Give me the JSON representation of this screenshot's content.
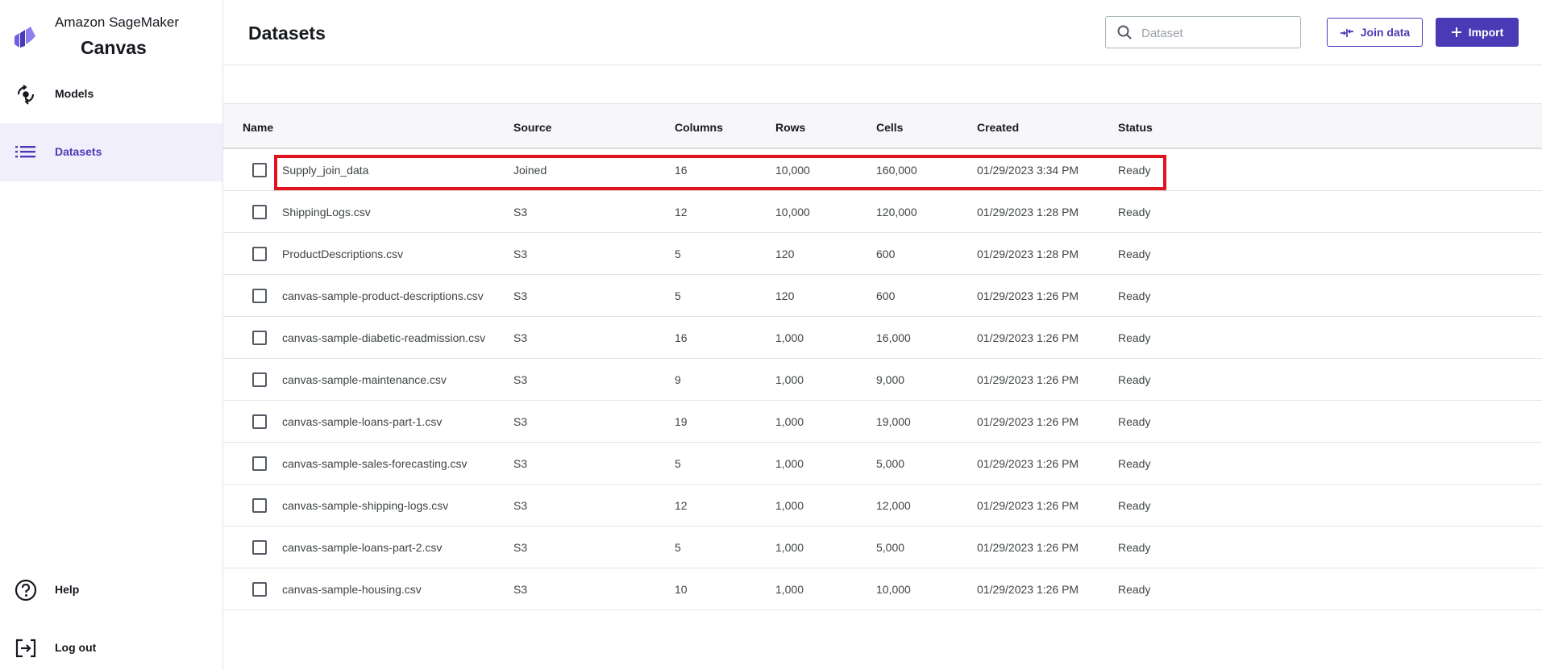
{
  "app": {
    "brand_sub": "Amazon SageMaker",
    "brand_title": "Canvas",
    "accent_color": "#4b3ab5",
    "highlight_color": "#e0141e"
  },
  "sidebar": {
    "items": [
      {
        "label": "Models",
        "icon": "models-icon",
        "active": false
      },
      {
        "label": "Datasets",
        "icon": "list-icon",
        "active": true
      }
    ],
    "bottom_items": [
      {
        "label": "Help",
        "icon": "help-icon"
      },
      {
        "label": "Log out",
        "icon": "logout-icon"
      }
    ]
  },
  "header": {
    "title": "Datasets",
    "search_placeholder": "Dataset",
    "join_label": "Join data",
    "import_label": "Import"
  },
  "table": {
    "columns": [
      "Name",
      "Source",
      "Columns",
      "Rows",
      "Cells",
      "Created",
      "Status"
    ],
    "rows": [
      {
        "name": "Supply_join_data",
        "source": "Joined",
        "columns": "16",
        "rows": "10,000",
        "cells": "160,000",
        "created": "01/29/2023 3:34 PM",
        "status": "Ready",
        "highlighted": true
      },
      {
        "name": "ShippingLogs.csv",
        "source": "S3",
        "columns": "12",
        "rows": "10,000",
        "cells": "120,000",
        "created": "01/29/2023 1:28 PM",
        "status": "Ready"
      },
      {
        "name": "ProductDescriptions.csv",
        "source": "S3",
        "columns": "5",
        "rows": "120",
        "cells": "600",
        "created": "01/29/2023 1:28 PM",
        "status": "Ready"
      },
      {
        "name": "canvas-sample-product-descriptions.csv",
        "source": "S3",
        "columns": "5",
        "rows": "120",
        "cells": "600",
        "created": "01/29/2023 1:26 PM",
        "status": "Ready"
      },
      {
        "name": "canvas-sample-diabetic-readmission.csv",
        "source": "S3",
        "columns": "16",
        "rows": "1,000",
        "cells": "16,000",
        "created": "01/29/2023 1:26 PM",
        "status": "Ready"
      },
      {
        "name": "canvas-sample-maintenance.csv",
        "source": "S3",
        "columns": "9",
        "rows": "1,000",
        "cells": "9,000",
        "created": "01/29/2023 1:26 PM",
        "status": "Ready"
      },
      {
        "name": "canvas-sample-loans-part-1.csv",
        "source": "S3",
        "columns": "19",
        "rows": "1,000",
        "cells": "19,000",
        "created": "01/29/2023 1:26 PM",
        "status": "Ready"
      },
      {
        "name": "canvas-sample-sales-forecasting.csv",
        "source": "S3",
        "columns": "5",
        "rows": "1,000",
        "cells": "5,000",
        "created": "01/29/2023 1:26 PM",
        "status": "Ready"
      },
      {
        "name": "canvas-sample-shipping-logs.csv",
        "source": "S3",
        "columns": "12",
        "rows": "1,000",
        "cells": "12,000",
        "created": "01/29/2023 1:26 PM",
        "status": "Ready"
      },
      {
        "name": "canvas-sample-loans-part-2.csv",
        "source": "S3",
        "columns": "5",
        "rows": "1,000",
        "cells": "5,000",
        "created": "01/29/2023 1:26 PM",
        "status": "Ready"
      },
      {
        "name": "canvas-sample-housing.csv",
        "source": "S3",
        "columns": "10",
        "rows": "1,000",
        "cells": "10,000",
        "created": "01/29/2023 1:26 PM",
        "status": "Ready"
      }
    ]
  }
}
